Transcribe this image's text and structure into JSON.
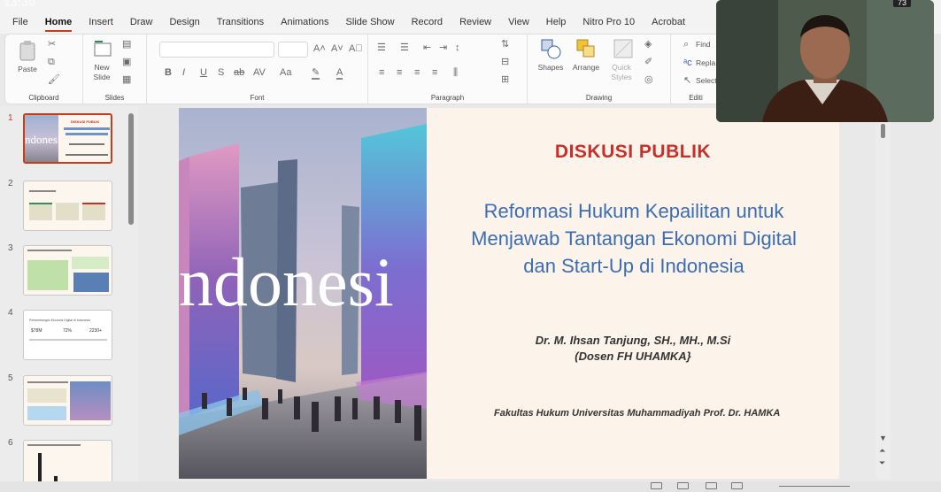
{
  "menubar": {
    "clock": "13:30",
    "tabs": [
      "File",
      "Home",
      "Insert",
      "Draw",
      "Design",
      "Transitions",
      "Animations",
      "Slide Show",
      "Record",
      "Review",
      "View",
      "Help",
      "Nitro Pro 10",
      "Acrobat"
    ],
    "active_tab": "Home"
  },
  "ribbon": {
    "clipboard": {
      "paste_label": "Paste",
      "group_label": "Clipboard"
    },
    "slides": {
      "new_label": "New",
      "slide_label": "Slide",
      "group_label": "Slides"
    },
    "font": {
      "font_name": "",
      "font_size": "",
      "group_label": "Font"
    },
    "paragraph": {
      "group_label": "Paragraph"
    },
    "drawing": {
      "shapes_label": "Shapes",
      "arrange_label": "Arrange",
      "quick_label": "Quick",
      "styles_label": "Styles",
      "group_label": "Drawing"
    },
    "editing": {
      "find_label": "Find",
      "replace_label": "Repla",
      "select_label": "Select",
      "group_label": "Editi"
    }
  },
  "thumbnails": {
    "numbers": [
      "1",
      "2",
      "3",
      "4",
      "5",
      "6"
    ],
    "active": "1",
    "t1": {
      "word": "ndonesi",
      "title": "DISKUSI PUBLIK"
    },
    "t4": {
      "title": "Perkembangan Ekonomi Digital di Indonesia",
      "stat1": "$78M",
      "stat2": "72%",
      "stat3": "2230+"
    }
  },
  "slide": {
    "photo_word": "ndonesi",
    "title": "DISKUSI PUBLIK",
    "subtitle_lines": [
      "Reformasi Hukum Kepailitan untuk",
      "Menjawab Tantangan Ekonomi Digital",
      "dan Start-Up di Indonesia"
    ],
    "author": "Dr. M. Ihsan Tanjung, SH., MH., M.Si",
    "affiliation": "(Dosen FH UHAMKA}",
    "faculty": "Fakultas Hukum Universitas Muhammadiyah Prof. Dr. HAMKA"
  },
  "webcam": {
    "battery": "73"
  },
  "colors": {
    "accent": "#c43e1c",
    "title_red": "#c5302b",
    "subtitle_blue": "#3b6db3"
  }
}
